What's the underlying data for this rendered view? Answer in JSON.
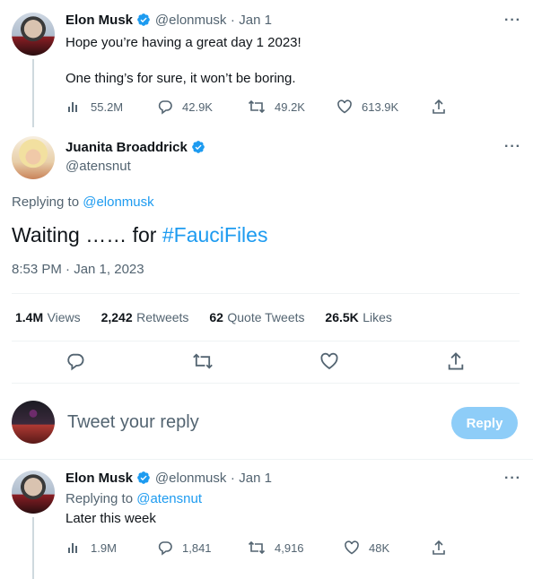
{
  "colors": {
    "accent": "#1d9bf0",
    "muted": "#536471",
    "text": "#0f1419",
    "reply_button": "#8ecdf8"
  },
  "tweet1": {
    "name": "Elon Musk",
    "handle": "@elonmusk",
    "dot": "·",
    "date": "Jan 1",
    "text_line1": "Hope you’re having a great day 1 2023!",
    "text_line2": "One thing’s for sure, it won’t be boring.",
    "views": "55.2M",
    "replies": "42.9K",
    "retweets": "49.2K",
    "likes": "613.9K"
  },
  "main_tweet": {
    "name": "Juanita Broaddrick",
    "handle": "@atensnut",
    "replying_prefix": "Replying to",
    "replying_to": "@elonmusk",
    "text": "Waiting …… for",
    "hashtag": "#FauciFiles",
    "timestamp": "8:53 PM · Jan 1, 2023",
    "stats": {
      "views_num": "1.4M",
      "views_lbl": "Views",
      "retweets_num": "2,242",
      "retweets_lbl": "Retweets",
      "quotes_num": "62",
      "quotes_lbl": "Quote Tweets",
      "likes_num": "26.5K",
      "likes_lbl": "Likes"
    }
  },
  "reply_box": {
    "placeholder": "Tweet your reply",
    "button": "Reply"
  },
  "tweet3": {
    "name": "Elon Musk",
    "handle": "@elonmusk",
    "dot": "·",
    "date": "Jan 1",
    "replying_prefix": "Replying to",
    "replying_to": "@atensnut",
    "text": "Later this week",
    "views": "1.9M",
    "replies": "1,841",
    "retweets": "4,916",
    "likes": "48K"
  },
  "icons": [
    "verified-badge-icon",
    "more-icon",
    "views-icon",
    "reply-icon",
    "retweet-icon",
    "like-icon",
    "share-icon"
  ]
}
